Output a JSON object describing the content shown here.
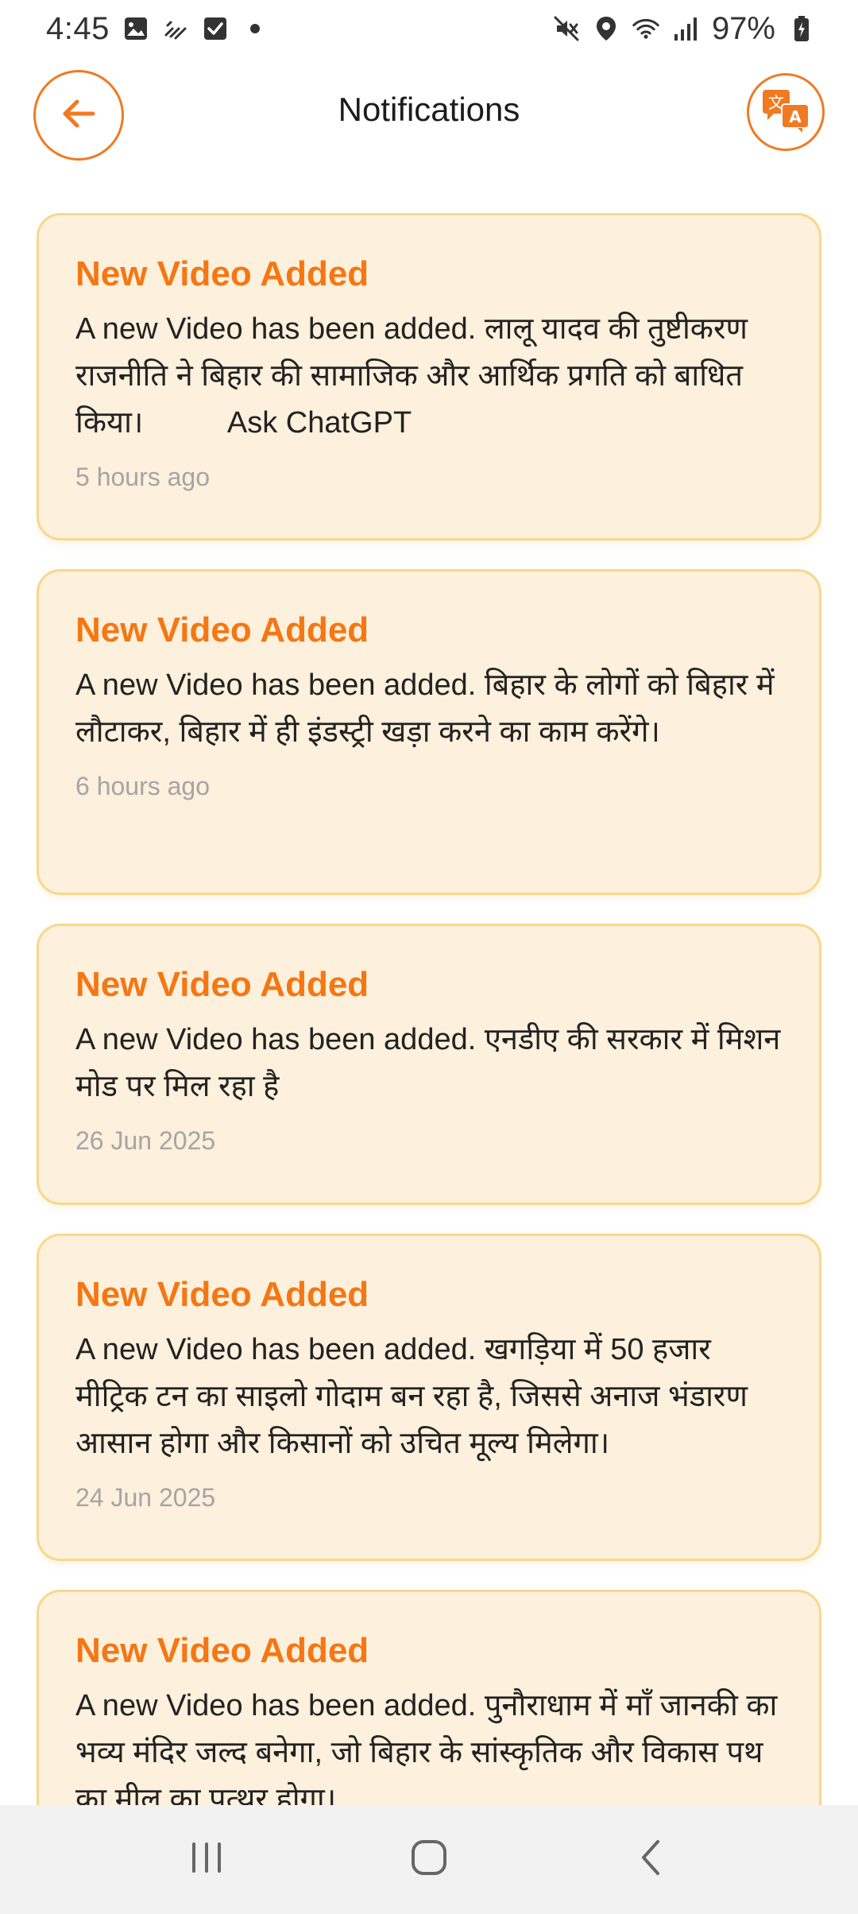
{
  "status_bar": {
    "time": "4:45",
    "battery_percent": "97%",
    "left_icons": [
      "gallery-icon",
      "missed-call-icon",
      "checkbox-icon",
      "dot-icon"
    ],
    "right_icons": [
      "mute-icon",
      "location-icon",
      "wifi-icon",
      "signal-icon",
      "battery-icon"
    ]
  },
  "header": {
    "title": "Notifications",
    "back_icon": "arrow-left-icon",
    "translate_icon": "translate-icon"
  },
  "colors": {
    "accent": "#f47714",
    "card_bg": "#fdf0dc",
    "card_border": "#f8d88a",
    "timestamp": "#a5a5a5"
  },
  "notifications": [
    {
      "title": "New Video Added",
      "body": "A new Video has been added. लालू यादव की तुष्टीकरण राजनीति ने बिहार की सामाजिक और आर्थिक प्रगति को बाधित किया।          Ask ChatGPT",
      "time": "5 hours ago"
    },
    {
      "title": "New Video Added",
      "body": "A new Video has been added. बिहार के लोगों को बिहार में लौटाकर, बिहार में ही इंडस्ट्री खड़ा करने का काम करेंगे।",
      "time": "6 hours ago"
    },
    {
      "title": "New Video Added",
      "body": "A new Video has been added. एनडीए की सरकार में मिशन मोड पर मिल रहा है",
      "time": "26 Jun 2025"
    },
    {
      "title": "New Video Added",
      "body": "A new Video has been added. खगड़िया में 50 हजार मीट्रिक टन का साइलो गोदाम बन रहा है, जिससे अनाज भंडारण आसान होगा और किसानों को उचित मूल्य मिलेगा।",
      "time": "24 Jun 2025"
    },
    {
      "title": "New Video Added",
      "body": "A new Video has been added. पुनौराधाम में माँ जानकी का भव्य मंदिर जल्द बनेगा, जो बिहार के सांस्कृतिक और विकास पथ का मील का पत्थर होगा।",
      "time": ""
    }
  ],
  "nav_bar": {
    "icons": [
      "recent-apps-icon",
      "home-icon",
      "back-nav-icon"
    ]
  }
}
